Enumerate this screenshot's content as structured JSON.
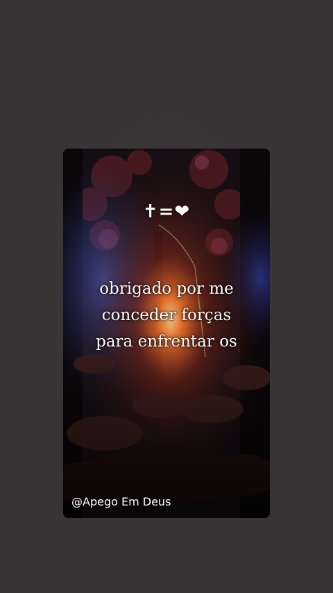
{
  "story": {
    "symbols": {
      "cross": "✝",
      "equals": "=",
      "heart": "❤"
    },
    "quote_lines": [
      "obrigado por me",
      "conceder forças",
      "para enfrentar os"
    ],
    "credit": "@Apego Em Deus"
  },
  "colors": {
    "page_background": "#3a3739",
    "card_background": "#120d10",
    "text": "#ffffff",
    "glow_orange": "#ff7a2a",
    "glow_blue": "#3a5cff"
  }
}
